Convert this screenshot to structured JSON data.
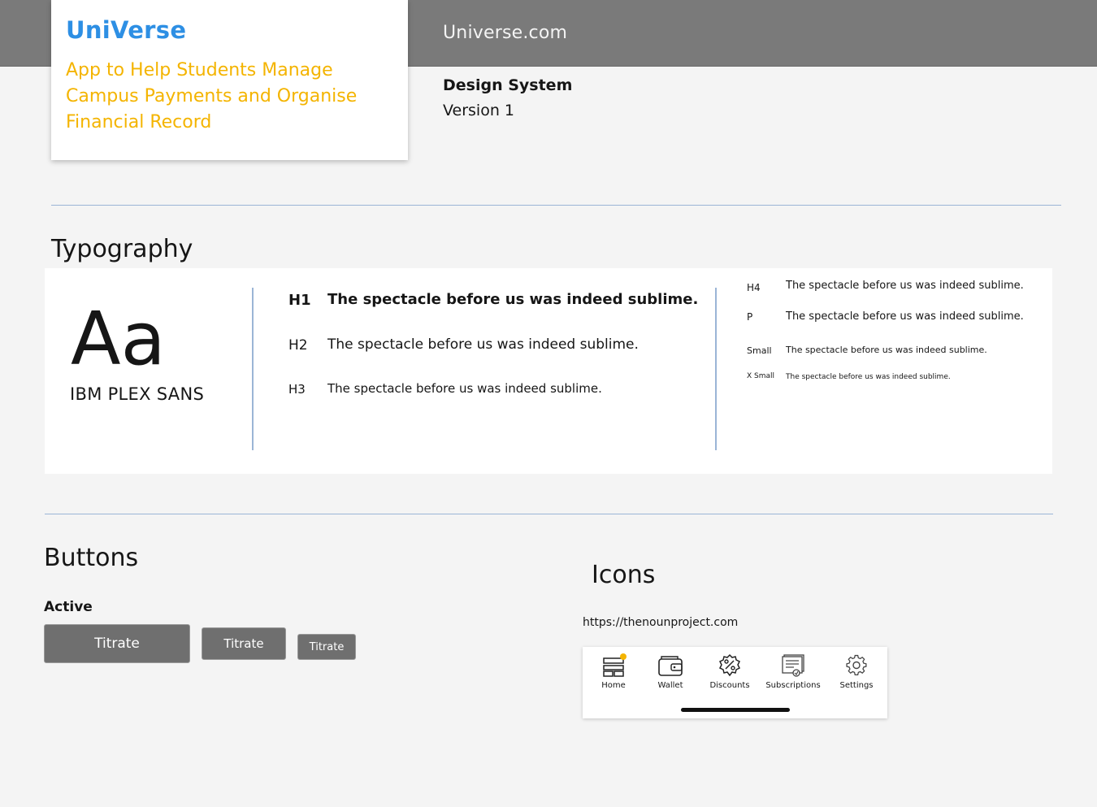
{
  "header": {
    "site_name": "Universe.com"
  },
  "brand": {
    "title": "UniVerse",
    "tagline": "App to Help Students Manage Campus Payments and Organise Financial Record",
    "title_color": "#2d8fe4",
    "tagline_color": "#f4b400"
  },
  "design_system": {
    "title": "Design System",
    "version": "Version 1"
  },
  "typography": {
    "section_title": "Typography",
    "sample_glyphs": "Aa",
    "font_name": "IBM PLEX SANS",
    "styles": [
      {
        "label": "H1",
        "sample": "The spectacle before us was indeed sublime."
      },
      {
        "label": "H2",
        "sample": "The spectacle before us was indeed sublime."
      },
      {
        "label": "H3",
        "sample": "The spectacle before us was indeed sublime."
      },
      {
        "label": "H4",
        "sample": "The spectacle before us was indeed sublime."
      },
      {
        "label": "P",
        "sample": "The spectacle before us was indeed sublime."
      },
      {
        "label": "Small",
        "sample": "The spectacle before us was indeed sublime."
      },
      {
        "label": "X Small",
        "sample": "The spectacle before us was indeed sublime."
      }
    ]
  },
  "buttons": {
    "section_title": "Buttons",
    "state_label": "Active",
    "items": [
      {
        "label": "Titrate",
        "size": "large"
      },
      {
        "label": "Titrate",
        "size": "medium"
      },
      {
        "label": "Titrate",
        "size": "small"
      }
    ],
    "color": "#6f6f6f"
  },
  "icons": {
    "section_title": "Icons",
    "source": "https://thenounproject.com",
    "nav": [
      {
        "label": "Home",
        "icon": "home-icon",
        "badge": true
      },
      {
        "label": "Wallet",
        "icon": "wallet-icon"
      },
      {
        "label": "Discounts",
        "icon": "discount-icon"
      },
      {
        "label": "Subscriptions",
        "icon": "subscriptions-icon"
      },
      {
        "label": "Settings",
        "icon": "gear-icon"
      }
    ],
    "badge_color": "#f4b400"
  }
}
